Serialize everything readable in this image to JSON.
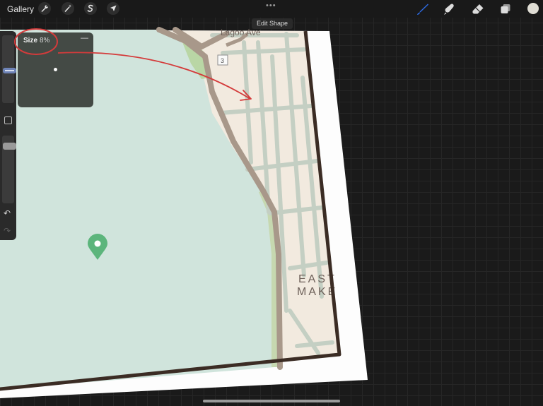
{
  "toolbar": {
    "gallery_label": "Gallery",
    "left_tools": [
      "wrench-icon",
      "magic-wand-icon",
      "selection-icon",
      "transform-arrow-icon"
    ],
    "right_tools": [
      "brush-icon",
      "smudge-icon",
      "eraser-icon",
      "layers-icon"
    ],
    "more_label": "•••",
    "active_color": "#dfddd4",
    "accent_color": "#2d6be4"
  },
  "edit_shape": {
    "label": "Edit Shape"
  },
  "size_popup": {
    "label": "Size",
    "value": "8%",
    "close_label": "—"
  },
  "sidebar": {
    "brush_size_level": 0.48,
    "opacity_level": 0.12,
    "undo_label": "↶",
    "redo_label": "↷"
  },
  "map": {
    "route_shield": "3",
    "street_label": "Lagoo Ave",
    "district_line1": "EAST",
    "district_line2": "MAKE"
  },
  "colors": {
    "water": "#d0e4dc",
    "land": "#f3ebe0",
    "street": "#c5cfc4",
    "road": "#a8998b",
    "map_border": "#3b2c24",
    "annotation": "#d43b3b",
    "pin": "#5cb57c"
  }
}
